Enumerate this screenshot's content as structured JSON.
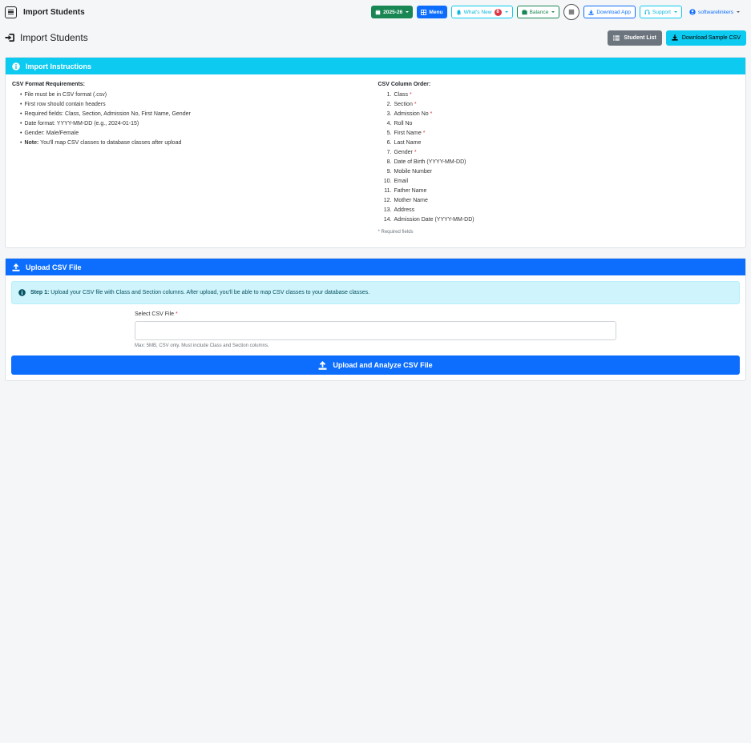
{
  "topbar": {
    "title": "Import Students",
    "session_label": "2025-26",
    "menu_label": "Menu",
    "whats_new_label": "What's New",
    "whats_new_badge": "8",
    "balance_label": "Balance",
    "download_app_label": "Download App",
    "support_label": "Support",
    "user_label": "softwarelinkers"
  },
  "page": {
    "title": "Import Students",
    "student_list_label": "Student List",
    "download_sample_label": "Download Sample CSV"
  },
  "instructions": {
    "header": "Import Instructions",
    "requirements_title": "CSV Format Requirements:",
    "requirements": [
      "File must be in CSV format (.csv)",
      "First row should contain headers",
      "Required fields: Class, Section, Admission No, First Name, Gender",
      "Date format: YYYY-MM-DD (e.g., 2024-01-15)",
      "Gender: Male/Female"
    ],
    "note_label": "Note:",
    "note_text": "You'll map CSV classes to database classes after upload",
    "order_title": "CSV Column Order:",
    "columns": [
      {
        "num": "1.",
        "name": "Class",
        "req": "*"
      },
      {
        "num": "2.",
        "name": "Section",
        "req": "*"
      },
      {
        "num": "3.",
        "name": "Admission No",
        "req": "*"
      },
      {
        "num": "4.",
        "name": "Roll No",
        "req": ""
      },
      {
        "num": "5.",
        "name": "First Name",
        "req": "*"
      },
      {
        "num": "6.",
        "name": "Last Name",
        "req": ""
      },
      {
        "num": "7.",
        "name": "Gender",
        "req": "*"
      },
      {
        "num": "8.",
        "name": "Date of Birth (YYYY-MM-DD)",
        "req": ""
      },
      {
        "num": "9.",
        "name": "Mobile Number",
        "req": ""
      },
      {
        "num": "10.",
        "name": "Email",
        "req": ""
      },
      {
        "num": "11.",
        "name": "Father Name",
        "req": ""
      },
      {
        "num": "12.",
        "name": "Mother Name",
        "req": ""
      },
      {
        "num": "13.",
        "name": "Address",
        "req": ""
      },
      {
        "num": "14.",
        "name": "Admission Date (YYYY-MM-DD)",
        "req": ""
      }
    ],
    "required_note": "* Required fields"
  },
  "upload": {
    "header": "Upload CSV File",
    "step_label": "Step 1:",
    "step_text": "Upload your CSV file with Class and Section columns. After upload, you'll be able to map CSV classes to your database classes.",
    "field_label": "Select CSV File",
    "required_star": "*",
    "help_text": "Max: 5MB, CSV only. Must include Class and Section columns.",
    "submit_label": "Upload and Analyze CSV File"
  },
  "colors": {
    "info": "#0dcaf0",
    "primary": "#0d6efd",
    "success": "#198754",
    "secondary": "#6c757d",
    "danger": "#dc3545"
  }
}
